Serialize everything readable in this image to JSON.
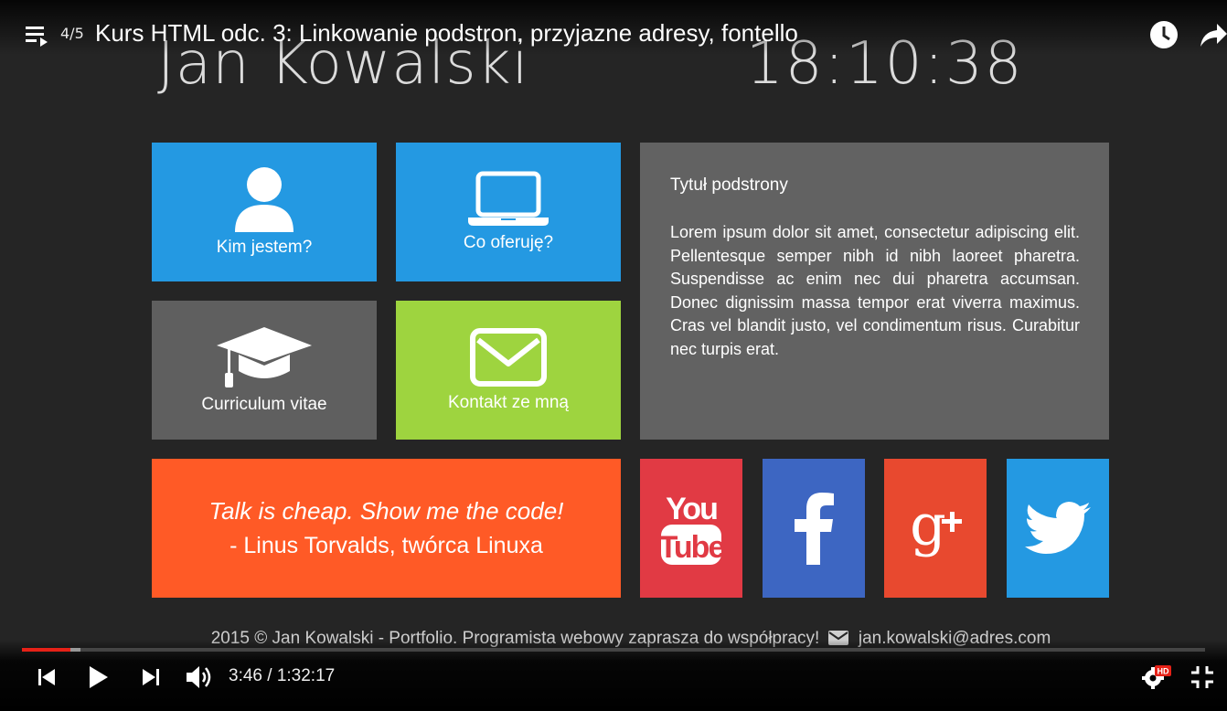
{
  "player": {
    "playlist_counter": "4/5",
    "video_title": "Kurs HTML odc. 3: Linkowanie podstron, przyjazne adresy, fontello",
    "time_display": "3:46 / 1:32:17",
    "progress_fraction": 0.041,
    "quality_badge": "HD",
    "accent_color": "#e62117"
  },
  "site": {
    "name": "Jan Kowalski",
    "clock": "18:10:38"
  },
  "tiles": [
    {
      "label": "Kim jestem?",
      "icon": "user-icon",
      "color": "#2499e2"
    },
    {
      "label": "Co oferuję?",
      "icon": "laptop-icon",
      "color": "#2499e2"
    },
    {
      "label": "Curriculum vitae",
      "icon": "graduation-cap-icon",
      "color": "#5f5f5f"
    },
    {
      "label": "Kontakt ze mną",
      "icon": "envelope-icon",
      "color": "#9ed43f"
    }
  ],
  "content": {
    "title": "Tytuł podstrony",
    "text": "Lorem ipsum dolor sit amet, consectetur adipiscing elit. Pellentesque semper nibh id nibh laoreet pharetra. Suspendisse ac enim nec dui pharetra accumsan. Donec dignissim massa tempor erat viverra maximus. Cras vel blandit justo, vel condimentum risus. Curabitur nec turpis erat."
  },
  "quote": {
    "text": "Talk is cheap. Show me the code!",
    "author": "- Linus Torvalds, twórca Linuxa",
    "color": "#ff5a26"
  },
  "social": [
    {
      "name": "YouTube",
      "icon": "youtube-icon",
      "color": "#e13a44"
    },
    {
      "name": "Facebook",
      "icon": "facebook-icon",
      "color": "#3d66c2"
    },
    {
      "name": "Google+",
      "icon": "google-plus-icon",
      "color": "#e8492f"
    },
    {
      "name": "Twitter",
      "icon": "twitter-icon",
      "color": "#2499e2"
    }
  ],
  "footer": {
    "text": "2015 © Jan Kowalski - Portfolio. Programista webowy zaprasza do współpracy!",
    "email": "jan.kowalski@adres.com"
  }
}
